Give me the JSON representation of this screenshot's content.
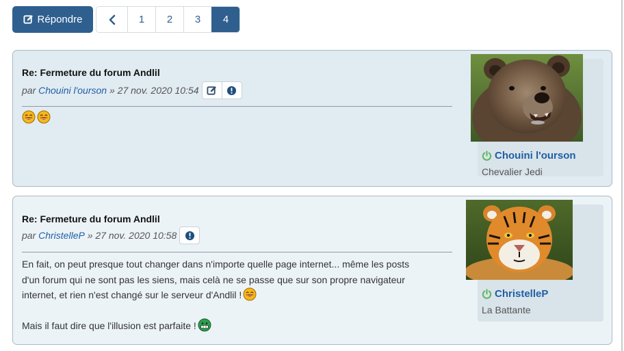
{
  "action_bar": {
    "reply_label": "Répondre",
    "pages": [
      "1",
      "2",
      "3",
      "4"
    ],
    "current_page": "4"
  },
  "posts": [
    {
      "title": "Re: Fermeture du forum Andlil",
      "by": "par",
      "author": "Chouini l'ourson",
      "datetime": "» 27 nov. 2020 10:54",
      "buttons": [
        "edit-icon",
        "report-icon"
      ],
      "content_emojis": [
        "laughing-emoji",
        "laughing-emoji"
      ],
      "profile": {
        "username": "Chouini l'ourson",
        "rank": "Chevalier Jedi",
        "status": "online"
      }
    },
    {
      "title": "Re: Fermeture du forum Andlil",
      "by": "par",
      "author": "ChristelleP",
      "datetime": "» 27 nov. 2020 10:58",
      "buttons": [
        "report-icon"
      ],
      "content": {
        "line1": "En fait, on peut presque tout changer dans n'importe quelle page internet... même les posts",
        "line2": "d'un forum qui ne sont pas les siens, mais celà ne se passe que sur son propre navigateur",
        "line3": "internet, et rien n'est changé sur le serveur d'Andlil !",
        "line4": "Mais il faut dire que l'illusion est parfaite !"
      },
      "profile": {
        "username": "ChristelleP",
        "rank": "La Battante",
        "status": "online"
      }
    }
  ],
  "colors": {
    "primary": "#2f5f8f",
    "link": "#1f5fa3",
    "post_bg_1": "#e1ebf2",
    "post_bg_2": "#ecf3f7",
    "online": "#5cb85c"
  }
}
